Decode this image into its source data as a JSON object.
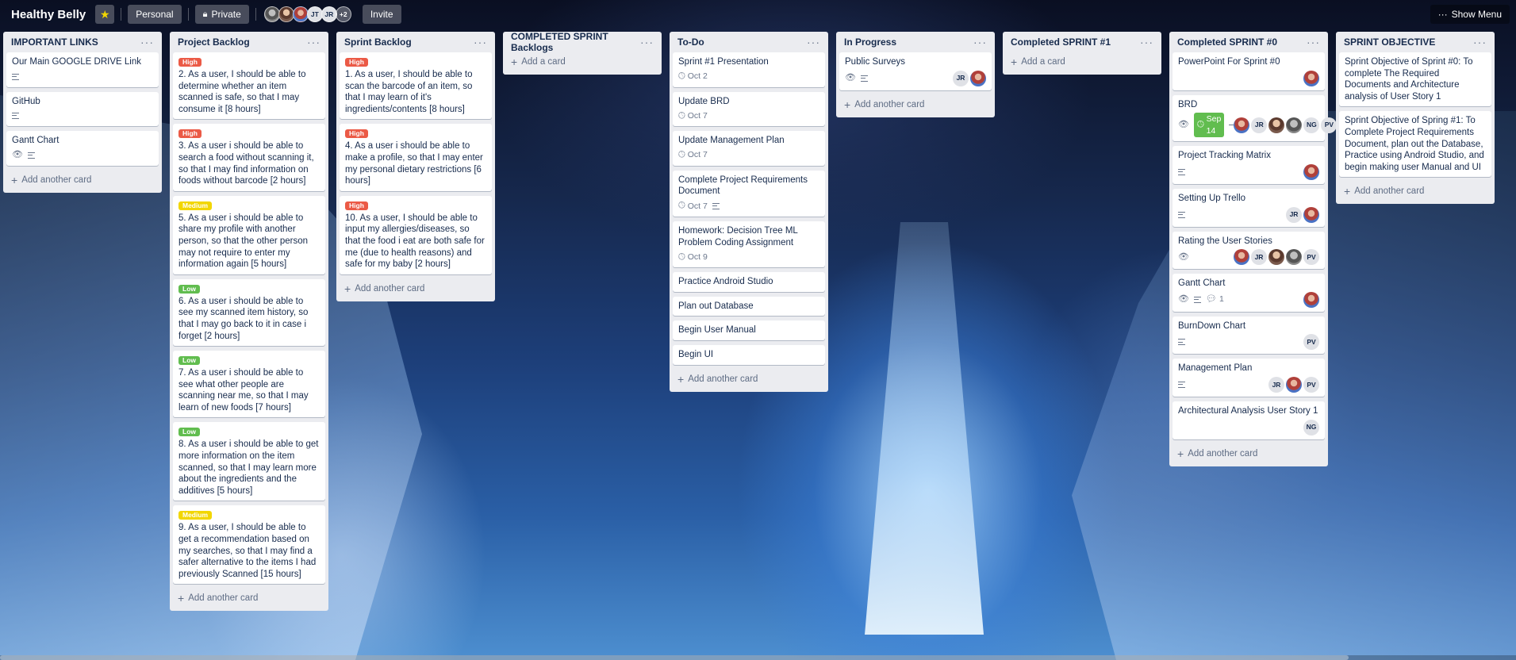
{
  "header": {
    "board_title": "Healthy Belly",
    "personal_label": "Personal",
    "private_label": "Private",
    "members": [
      "",
      "",
      "",
      "JT",
      "JR"
    ],
    "more_members": "+2",
    "invite_label": "Invite",
    "show_menu_label": "Show Menu"
  },
  "common": {
    "add_another_card": "Add another card",
    "add_a_card": "Add a card",
    "menu": "···"
  },
  "lists": [
    {
      "title": "IMPORTANT LINKS",
      "cards": [
        {
          "title": "Our Main GOOGLE DRIVE Link"
        },
        {
          "title": "GitHub"
        },
        {
          "title": "Gantt Chart"
        }
      ]
    },
    {
      "title": "Project Backlog",
      "cards": [
        {
          "label": "High",
          "title": "2. As a user, I should be able to determine whether an item scanned is safe, so that I may consume it [8 hours]"
        },
        {
          "label": "High",
          "title": "3. As a user i should be able to search a food without scanning it, so that I may find information on foods without barcode [2 hours]"
        },
        {
          "label": "Medium",
          "title": "5. As a user i should be able to share my profile with another person, so that the other person may not require to enter my information again [5 hours]"
        },
        {
          "label": "Low",
          "title": "6. As a user i should be able to see my scanned item history, so that I may go back to it in case i forget [2 hours]"
        },
        {
          "label": "Low",
          "title": "7. As a user i should be able to see what other people are scanning near me, so that I may learn of new foods [7 hours]"
        },
        {
          "label": "Low",
          "title": "8. As a user i should be able to get more information on the item scanned, so that I may learn more about the ingredients and the additives [5 hours]"
        },
        {
          "label": "Medium",
          "title": "9. As a user, I should be able to get a recommendation based on my searches, so that I may find a safer alternative to the items I had previously Scanned [15 hours]"
        }
      ]
    },
    {
      "title": "Sprint Backlog",
      "cards": [
        {
          "label": "High",
          "title": "1. As a user, I should be able to scan the barcode of an item, so that I may learn of it's ingredients/contents [8 hours]"
        },
        {
          "label": "High",
          "title": "4. As a user i should be able to make a profile, so that I may enter my personal dietary restrictions [6 hours]"
        },
        {
          "label": "High",
          "title": "10. As a user, I should be able to input my allergies/diseases, so that the food i eat are both safe for me (due to health reasons) and safe for my baby [2 hours]"
        }
      ]
    },
    {
      "title": "COMPLETED SPRINT Backlogs",
      "cards": []
    },
    {
      "title": "To-Do",
      "cards": [
        {
          "title": "Sprint #1 Presentation",
          "due": "Oct 2"
        },
        {
          "title": "Update BRD",
          "due": "Oct 7"
        },
        {
          "title": "Update Management Plan",
          "due": "Oct 7"
        },
        {
          "title": "Complete Project Requirements Document",
          "due": "Oct 7"
        },
        {
          "title": "Homework: Decision Tree ML Problem Coding Assignment",
          "due": "Oct 9"
        },
        {
          "title": "Practice Android Studio"
        },
        {
          "title": "Plan out Database"
        },
        {
          "title": "Begin User Manual"
        },
        {
          "title": "Begin UI"
        }
      ]
    },
    {
      "title": "In Progress",
      "cards": [
        {
          "title": "Public Surveys",
          "members": [
            "JR",
            ""
          ]
        }
      ]
    },
    {
      "title": "Completed SPRINT #1",
      "cards": []
    },
    {
      "title": "Completed SPRINT #0",
      "cards": [
        {
          "title": "PowerPoint For Sprint #0",
          "members": [
            ""
          ]
        },
        {
          "title": "BRD",
          "due": "Sep 14",
          "members": [
            "",
            "JR",
            "",
            "",
            "NG",
            "PV"
          ]
        },
        {
          "title": "Project Tracking Matrix",
          "members": [
            ""
          ]
        },
        {
          "title": "Setting Up Trello",
          "members": [
            "JR",
            ""
          ]
        },
        {
          "title": "Rating the User Stories",
          "members": [
            "",
            "JR",
            "",
            "",
            "PV"
          ]
        },
        {
          "title": "Gantt Chart",
          "comments": "1",
          "members": [
            ""
          ]
        },
        {
          "title": "BurnDown Chart",
          "members": [
            "PV"
          ]
        },
        {
          "title": "Management Plan",
          "members": [
            "JR",
            "",
            "PV"
          ]
        },
        {
          "title": "Architectural Analysis User Story 1",
          "members": [
            "NG"
          ]
        }
      ]
    },
    {
      "title": "SPRINT OBJECTIVE",
      "cards": [
        {
          "title": "Sprint Objective of Sprint #0: To complete The Required Documents and Architecture analysis of User Story 1"
        },
        {
          "title": "Sprint Objective of Spring #1: To Complete Project Requirements Document, plan out the Database, Practice using Android Studio, and begin making user Manual and UI"
        }
      ]
    }
  ],
  "colors": {
    "high": "#eb5a46",
    "medium": "#f2d600",
    "low": "#61bd4f",
    "list_bg": "#ebecf0"
  },
  "icons": [
    "star-icon",
    "lock-icon",
    "description-icon",
    "clock-icon",
    "eye-icon",
    "comment-icon",
    "plus-icon",
    "more-icon"
  ]
}
